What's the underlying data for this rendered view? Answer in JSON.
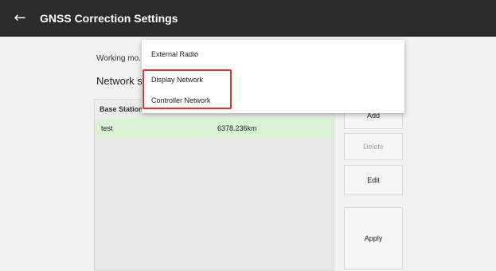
{
  "header": {
    "back_icon": "arrow-left-icon",
    "title": "GNSS Correction Settings"
  },
  "form": {
    "working_mode_label": "Working mo...",
    "network_label": "Network sta"
  },
  "table": {
    "columns": [
      "Base Station"
    ],
    "rows": [
      {
        "name": "test",
        "distance": "6378.236km",
        "selected": true
      }
    ]
  },
  "buttons": {
    "add": "Add",
    "delete": "Delete",
    "edit": "Edit",
    "apply": "Apply",
    "delete_disabled": true
  },
  "dropdown": {
    "options": [
      "External Radio",
      "Display Network",
      "Controller Network"
    ],
    "highlighted": [
      "Display Network",
      "Controller Network"
    ],
    "highlight_color": "#e53030"
  },
  "colors": {
    "topbar": "#2b2b2b",
    "selected_row": "#d9f2d3",
    "background": "#f2f2f2"
  }
}
